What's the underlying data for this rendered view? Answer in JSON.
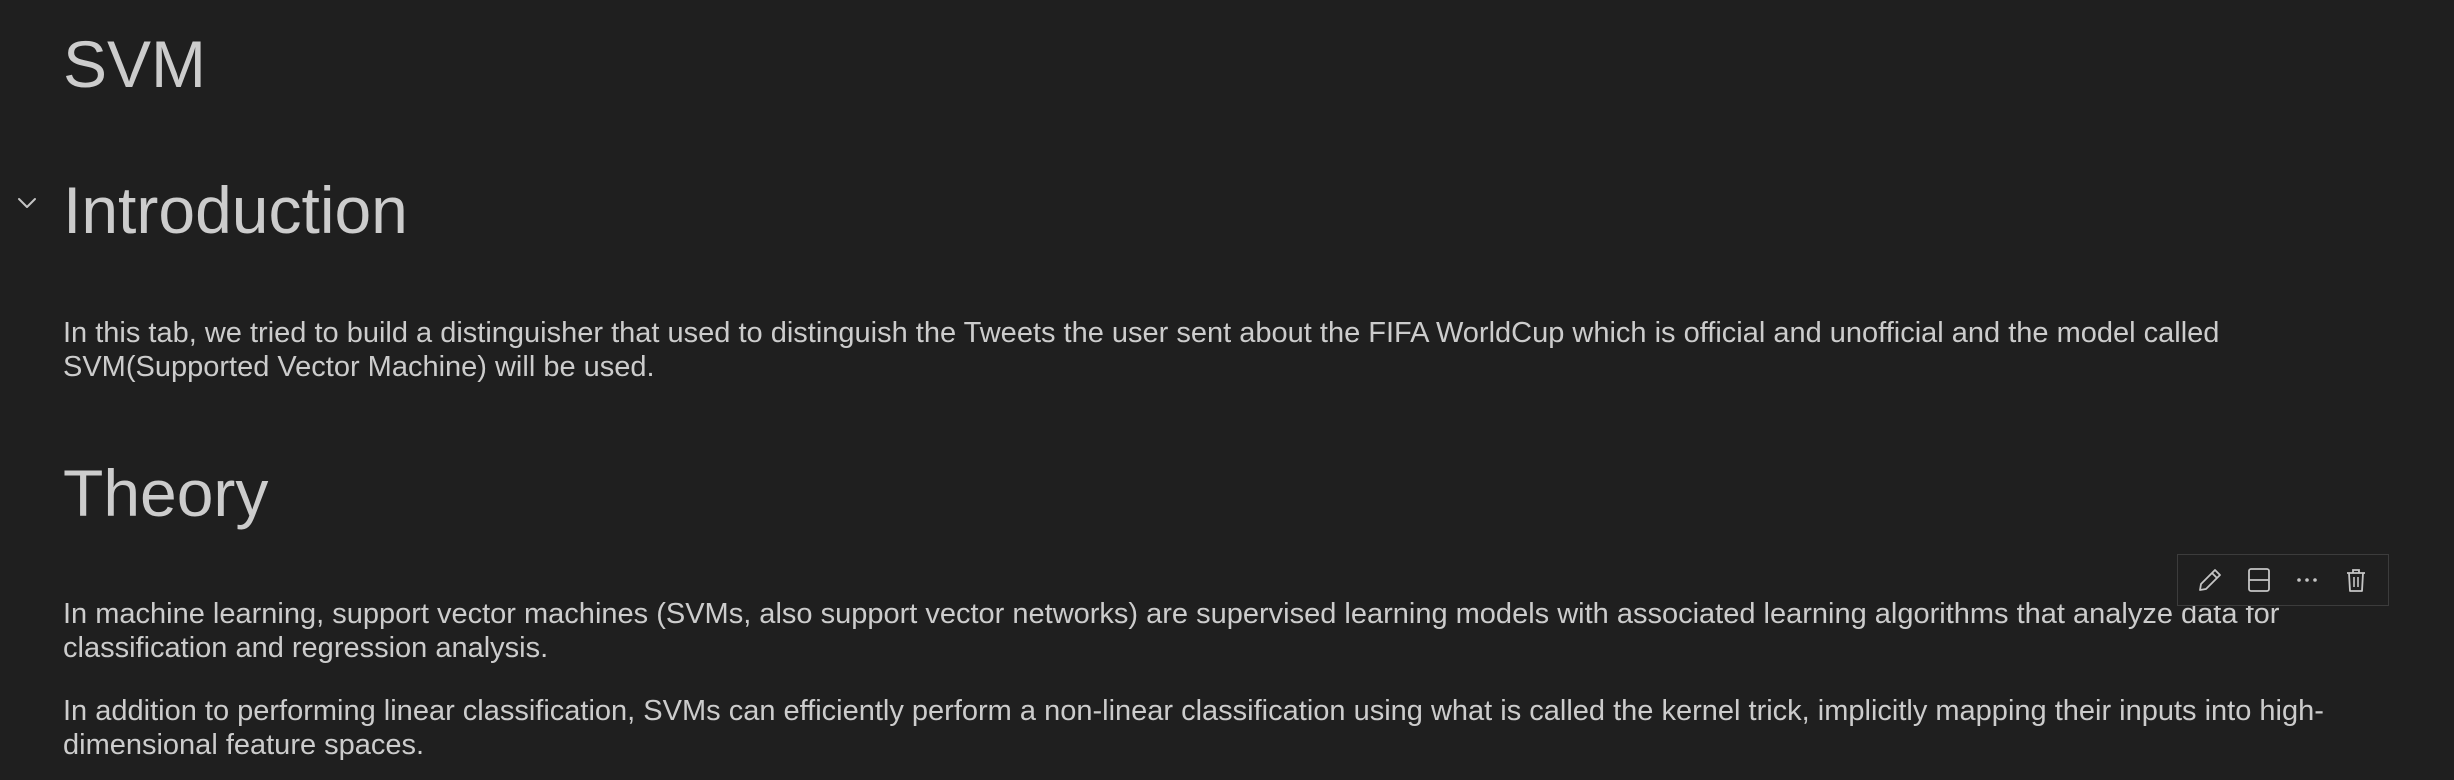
{
  "notebook": {
    "title": "SVM",
    "sections": {
      "introduction": {
        "heading": "Introduction",
        "paragraph": "In this tab, we tried to build a distinguisher that used to distinguish the Tweets the user sent about the FIFA WorldCup which is official and unofficial and the model called SVM(Supported Vector Machine) will be used."
      },
      "theory": {
        "heading": "Theory",
        "paragraphs": [
          "In machine learning, support vector machines (SVMs, also support vector networks) are supervised learning models with associated learning algorithms that analyze data for classification and regression analysis.",
          "In addition to performing linear classification, SVMs can efficiently perform a non-linear classification using what is called the kernel trick, implicitly mapping their inputs into high-dimensional feature spaces."
        ]
      }
    }
  },
  "cell_toolbar": {
    "icons": [
      "pencil-icon",
      "split-cell-icon",
      "more-icon",
      "trash-icon"
    ]
  },
  "colors": {
    "background": "#1f1f1f",
    "text": "#cccccc",
    "toolbar_border": "#3c3c3c"
  }
}
